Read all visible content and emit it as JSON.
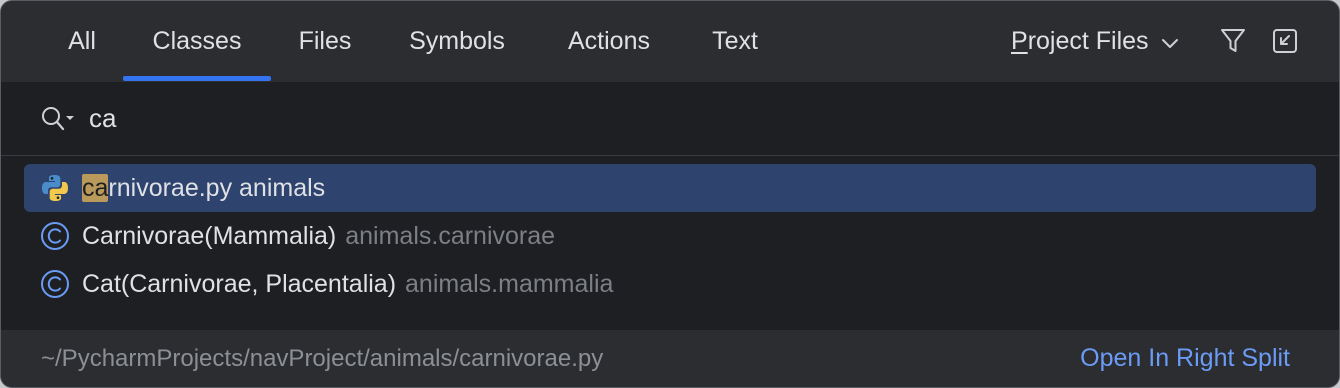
{
  "tabs": [
    {
      "label": "All",
      "active": false
    },
    {
      "label": "Classes",
      "active": true
    },
    {
      "label": "Files",
      "active": false
    },
    {
      "label": "Symbols",
      "active": false
    },
    {
      "label": "Actions",
      "active": false
    },
    {
      "label": "Text",
      "active": false
    }
  ],
  "scope": {
    "first_letter": "P",
    "rest": "roject Files",
    "icon": "chevron-down-icon"
  },
  "toolbar": {
    "filter_icon": "filter-icon",
    "collapse_icon": "open-in-window-icon"
  },
  "search": {
    "value": "ca",
    "icon": "search-icon"
  },
  "results": [
    {
      "match": "ca",
      "rest": "rnivorae.py animals",
      "location": "",
      "icon": "python-file-icon",
      "selected": true
    },
    {
      "match": "",
      "rest": "Carnivorae(Mammalia)",
      "location": "animals.carnivorae",
      "icon": "class-icon",
      "selected": false
    },
    {
      "match": "",
      "rest": "Cat(Carnivorae, Placentalia)",
      "location": "animals.mammalia",
      "icon": "class-icon",
      "selected": false
    }
  ],
  "footer": {
    "path": "~/PycharmProjects/navProject/animals/carnivorae.py",
    "action": "Open In Right Split"
  },
  "colors": {
    "accent": "#3574f0",
    "selection": "#2e436e",
    "highlight": "#b99a5a",
    "link": "#6b9bf5"
  }
}
